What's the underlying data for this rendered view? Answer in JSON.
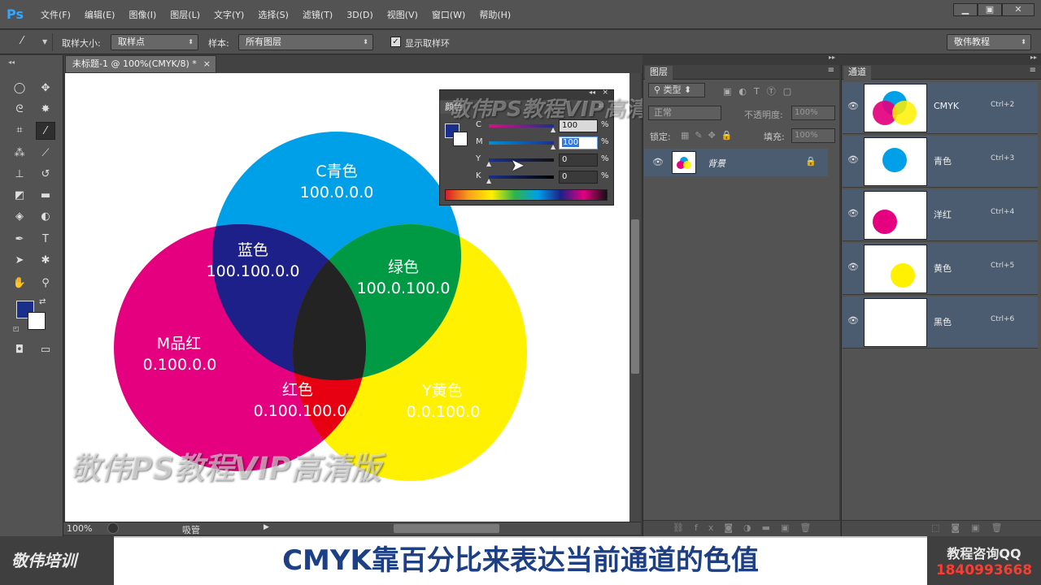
{
  "app": {
    "logo": "Ps"
  },
  "menu": [
    "文件(F)",
    "编辑(E)",
    "图像(I)",
    "图层(L)",
    "文字(Y)",
    "选择(S)",
    "滤镜(T)",
    "3D(D)",
    "视图(V)",
    "窗口(W)",
    "帮助(H)"
  ],
  "window_controls": {
    "minimize": "▁",
    "restore": "▣",
    "close": "✕"
  },
  "options": {
    "sample_size_label": "取样大小:",
    "sample_size_value": "取样点",
    "sample_label": "样本:",
    "sample_value": "所有图层",
    "show_ring_label": "显示取样环",
    "workspace": "敬伟教程"
  },
  "document": {
    "tab_title": "未标题-1 @ 100%(CMYK/8) *"
  },
  "status": {
    "zoom": "100%",
    "tool": "吸管"
  },
  "circles": {
    "cyan": {
      "name": "C青色",
      "value": "100.0.0.0"
    },
    "magenta": {
      "name": "M品红",
      "value": "0.100.0.0"
    },
    "yellow": {
      "name": "Y黄色",
      "value": "0.0.100.0"
    },
    "blue": {
      "name": "蓝色",
      "value": "100.100.0.0"
    },
    "green": {
      "name": "绿色",
      "value": "100.0.100.0"
    },
    "red": {
      "name": "红色",
      "value": "0.100.100.0"
    }
  },
  "color_panel": {
    "title": "颜色",
    "channels": [
      {
        "label": "C",
        "value": "100",
        "percent": "%"
      },
      {
        "label": "M",
        "value": "100",
        "percent": "%"
      },
      {
        "label": "Y",
        "value": "0",
        "percent": "%"
      },
      {
        "label": "K",
        "value": "0",
        "percent": "%"
      }
    ]
  },
  "layers_panel": {
    "tab": "图层",
    "filter": "类型",
    "blend": "正常",
    "opacity_label": "不透明度:",
    "opacity_value": "100%",
    "lock_label": "锁定:",
    "fill_label": "填充:",
    "fill_value": "100%",
    "layer_name": "背景"
  },
  "channels_panel": {
    "tab": "通道",
    "channels": [
      {
        "name": "CMYK",
        "shortcut": "Ctrl+2"
      },
      {
        "name": "青色",
        "shortcut": "Ctrl+3"
      },
      {
        "name": "洋红",
        "shortcut": "Ctrl+4"
      },
      {
        "name": "黄色",
        "shortcut": "Ctrl+5"
      },
      {
        "name": "黑色",
        "shortcut": "Ctrl+6"
      }
    ]
  },
  "watermark": {
    "text": "敬伟PS教程VIP高清版"
  },
  "caption": {
    "left_logo": "敬伟培训",
    "text": "CMYK靠百分比来表达当前通道的色值",
    "qq_label": "教程咨询QQ",
    "qq_number": "1840993668"
  },
  "colors": {
    "cyan": "#00a0e9",
    "magenta": "#e4007f",
    "yellow": "#fff100",
    "accent": "#1c3f86"
  }
}
